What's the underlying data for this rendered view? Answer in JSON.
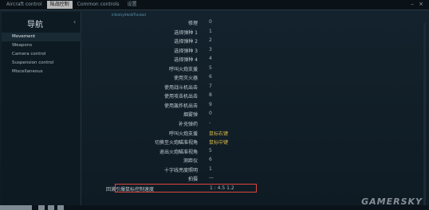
{
  "tabs": [
    "Aircraft control",
    "陆战控制",
    "Common controls",
    "设置"
  ],
  "active_tab_index": 1,
  "sidebar": {
    "title": "导航",
    "collapse_icon": "chevron-left-icon",
    "items": [
      "Movement",
      "Weapons",
      "Camera control",
      "Suspension control",
      "Miscellaneous"
    ],
    "active_index": 0
  },
  "section_header": "Infantry/Hold/Tracked",
  "rows": [
    {
      "label": "修理",
      "value": "0"
    },
    {
      "label": "选择弹种 1",
      "value": "1"
    },
    {
      "label": "选择弹种 2",
      "value": "2"
    },
    {
      "label": "选择弹种 3",
      "value": "3"
    },
    {
      "label": "选择弹种 4",
      "value": "4"
    },
    {
      "label": "呼叫火炮支援",
      "value": "5"
    },
    {
      "label": "使用灭火器",
      "value": "6"
    },
    {
      "label": "使用战斗机出击",
      "value": "7"
    },
    {
      "label": "使用攻击机出击",
      "value": "8"
    },
    {
      "label": "使用轰炸机出击",
      "value": "9"
    },
    {
      "label": "烟雾弹",
      "value": "0"
    },
    {
      "label": "补充弹药",
      "value": "-"
    },
    {
      "label": "呼叫火炮支援",
      "value": "鼠标右键",
      "accent": true
    },
    {
      "label": "切换至火炮瞄准视角",
      "value": "鼠标中键",
      "accent": true
    },
    {
      "label": "退出火炮瞄准视角",
      "value": "5"
    },
    {
      "label": "测距仪",
      "value": "6"
    },
    {
      "label": "十字线亮度照明",
      "value": "1"
    },
    {
      "label": "拍摄",
      "value": "—"
    },
    {
      "label": "回滚引爆鼠标控制速度",
      "value": "1 : 4.5 1.2",
      "highlight": true
    }
  ],
  "watermark": "GAMERSKY"
}
